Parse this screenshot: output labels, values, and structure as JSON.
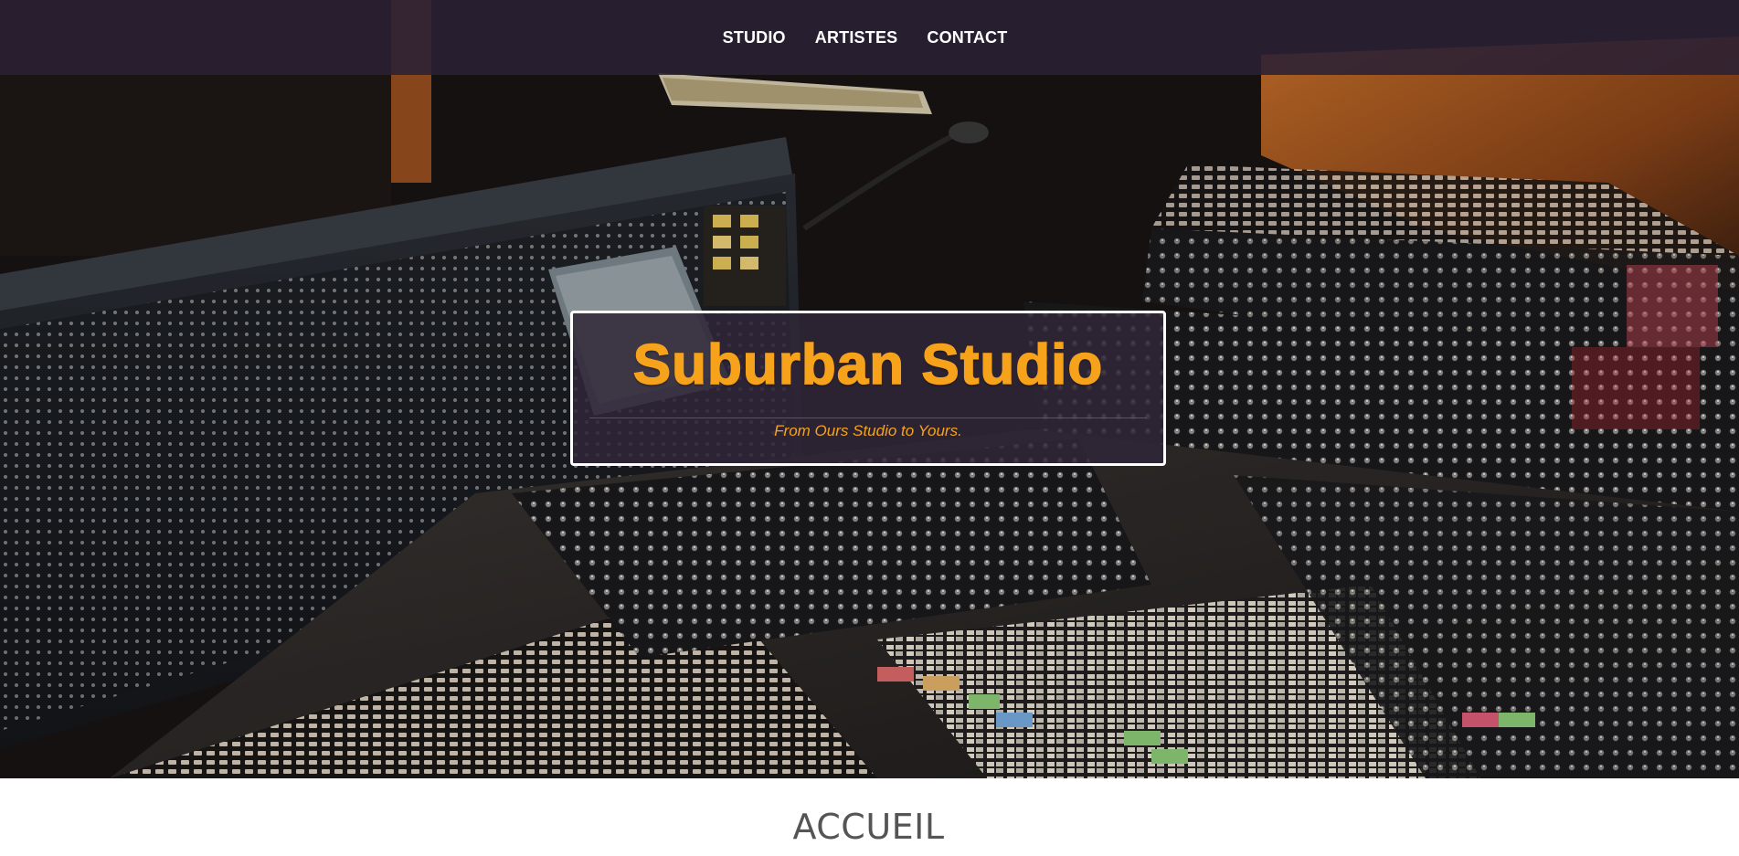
{
  "nav": {
    "items": [
      {
        "label": "STUDIO"
      },
      {
        "label": "ARTISTES"
      },
      {
        "label": "CONTACT"
      }
    ]
  },
  "hero": {
    "title": "Suburban Studio",
    "tagline": "From Ours Studio to Yours.",
    "background_image": "mixing-console-photo"
  },
  "section": {
    "heading": "ACCUEIL"
  },
  "colors": {
    "accent": "#f7a21b",
    "navbar": "#2a2034",
    "heading": "#555555"
  }
}
